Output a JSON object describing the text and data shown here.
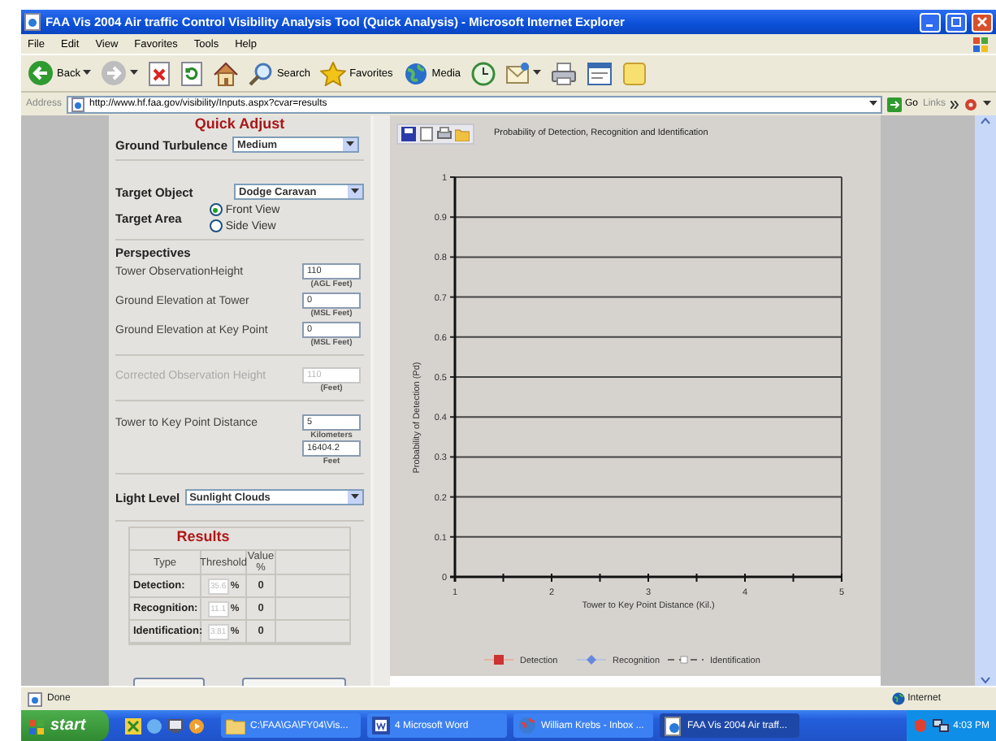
{
  "window": {
    "title": "FAA Vis 2004 Air traffic Control Visibility Analysis Tool (Quick Analysis) - Microsoft Internet Explorer"
  },
  "menu": [
    "File",
    "Edit",
    "View",
    "Favorites",
    "Tools",
    "Help"
  ],
  "toolbar": [
    {
      "kind": "back",
      "label": "Back"
    },
    {
      "kind": "forward"
    },
    {
      "kind": "stop"
    },
    {
      "kind": "refresh"
    },
    {
      "kind": "home"
    },
    {
      "kind": "search",
      "label": "Search"
    },
    {
      "kind": "favorites",
      "label": "Favorites"
    },
    {
      "kind": "media",
      "label": "Media"
    },
    {
      "kind": "history"
    },
    {
      "kind": "mail"
    },
    {
      "kind": "print"
    },
    {
      "kind": "edit"
    },
    {
      "kind": "note"
    }
  ],
  "address": {
    "label": "Address",
    "url": "http://www.hf.faa.gov/visibility/Inputs.aspx?cvar=results",
    "go": "Go",
    "links": "Links"
  },
  "form": {
    "heading": "Quick Adjust",
    "ground_turbulence": {
      "label": "Ground Turbulence",
      "value": "Medium"
    },
    "target_object": {
      "label": "Target Object",
      "value": "Dodge Caravan"
    },
    "target_area": {
      "label": "Target Area",
      "options": [
        {
          "label": "Front View",
          "selected": true
        },
        {
          "label": "Side View",
          "selected": false
        }
      ]
    },
    "perspectives": {
      "title": "Perspectives",
      "fields": [
        {
          "label": "Tower ObservationHeight",
          "value": "110",
          "unit": "(AGL Feet)"
        },
        {
          "label": "Ground Elevation at Tower",
          "value": "0",
          "unit": "(MSL Feet)"
        },
        {
          "label": "Ground Elevation at Key Point",
          "value": "0",
          "unit": "(MSL Feet)"
        }
      ]
    },
    "corrected_height": {
      "label": "Corrected Observation Height",
      "value": "110",
      "unit": "(Feet)",
      "disabled": true
    },
    "distance": {
      "label": "Tower to Key Point Distance",
      "fields": [
        {
          "value": "5",
          "unit": "Kilometers"
        },
        {
          "value": "16404.2",
          "unit": "Feet"
        }
      ]
    },
    "light_level": {
      "label": "Light Level",
      "value": "Sunlight Clouds"
    },
    "results": {
      "title": "Results",
      "columns": [
        "Type",
        "Threshold",
        "Value %"
      ],
      "rows": [
        {
          "type": "Detection:",
          "threshold": "35.6",
          "unit": "%",
          "value": "0"
        },
        {
          "type": "Recognition:",
          "threshold": "11.1",
          "unit": "%",
          "value": "0"
        },
        {
          "type": "Identification:",
          "threshold": "3.81",
          "unit": "%",
          "value": "0"
        }
      ]
    }
  },
  "chart_panel": {
    "chart_data": {
      "type": "line",
      "title": "Probability of Detection, Recognition and Identification",
      "xlabel": "Tower to Key Point Distance (Kil.)",
      "ylabel": "Probability of Detection (Pd)",
      "grid": true,
      "categories": [
        "1",
        "2",
        "3",
        "4",
        "5"
      ],
      "ylim": [
        0,
        1
      ],
      "yticks": [
        0,
        0.1,
        0.2,
        0.3,
        0.4,
        0.5,
        0.6,
        0.7,
        0.8,
        0.9,
        1
      ],
      "series": [
        {
          "name": "Detection",
          "color": "#cc3333",
          "marker": "square",
          "values": [
            null,
            null,
            null,
            null,
            null
          ]
        },
        {
          "name": "Recognition",
          "color": "#6688dd",
          "marker": "diamond",
          "values": [
            null,
            null,
            null,
            null,
            null
          ]
        },
        {
          "name": "Identification",
          "color": "#666666",
          "marker": "dash",
          "values": [
            null,
            null,
            null,
            null,
            null
          ]
        }
      ]
    }
  },
  "status_bar": {
    "text": "Done",
    "zone": "Internet"
  },
  "taskbar": {
    "start": "start",
    "tasks": [
      {
        "kind": "folder",
        "label": "C:\\FAA\\GA\\FY04\\Vis...",
        "selected": false
      },
      {
        "kind": "word",
        "label": "4 Microsoft Word",
        "selected": false
      },
      {
        "kind": "mail",
        "label": "William Krebs - Inbox ...",
        "selected": false
      },
      {
        "kind": "ie",
        "label": "FAA Vis 2004 Air traff...",
        "selected": true
      }
    ],
    "clock": "4:03 PM"
  }
}
